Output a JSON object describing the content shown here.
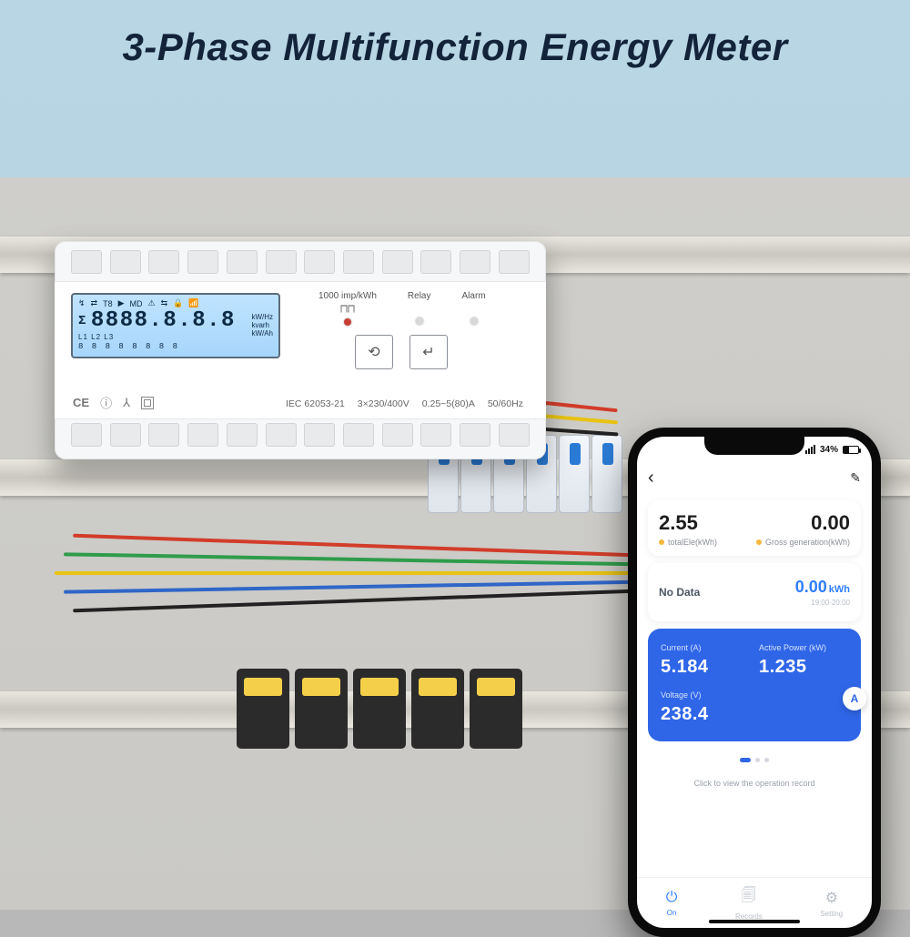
{
  "title": "3-Phase Multifunction Energy Meter",
  "meter": {
    "lcd": {
      "tariff": "T8",
      "md": "MD",
      "digits": "8888.8.8.8",
      "units": [
        "kW/Hz",
        "kvarh",
        "kW/Ah"
      ],
      "phases": "L1 L2 L3",
      "segments": "8 8 8 8 8 8 8 8"
    },
    "leds": {
      "pulse_rate": "1000 imp/kWh",
      "relay_label": "Relay",
      "alarm_label": "Alarm"
    },
    "badges": {
      "ce": "CE",
      "circ_i": "ⓘ",
      "wye": "⅄"
    },
    "spec": {
      "std": "IEC 62053-21",
      "voltage": "3×230/400V",
      "current": "0.25~5(80)A",
      "freq": "50/60Hz"
    }
  },
  "phone": {
    "status": {
      "time": "",
      "battery_pct": "34%"
    },
    "header": {},
    "stats": {
      "total_value": "2.55",
      "total_label": "totalEle(kWh)",
      "gross_value": "0.00",
      "gross_label": "Gross generation(kWh)"
    },
    "chart": {
      "no_data": "No Data",
      "kwh_value": "0.00",
      "kwh_unit": "kWh",
      "time_range": "19:00-20:00"
    },
    "live": {
      "current_label": "Current  (A)",
      "current_value": "5.184",
      "power_label": "Active Power  (kW)",
      "power_value": "1.235",
      "voltage_label": "Voltage  (V)",
      "voltage_value": "238.4",
      "fab": "A"
    },
    "op_record": "Click to view the operation record",
    "tabs": {
      "on": "On",
      "records": "Records",
      "setting": "Setting"
    }
  }
}
